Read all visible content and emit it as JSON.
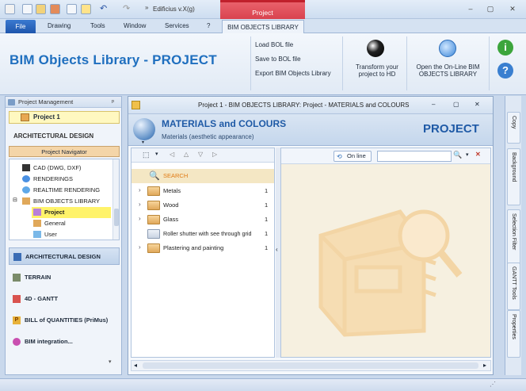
{
  "app": {
    "title": "Edificius v.X(g)",
    "context_tab_group": "Project"
  },
  "ribbon_tabs": {
    "file": "File",
    "drawing": "Drawing",
    "tools": "Tools",
    "window": "Window",
    "services": "Services",
    "help": "?",
    "active": "BIM OBJECTS LIBRARY"
  },
  "ribbon": {
    "big_title": "BIM Objects Library - PROJECT",
    "load": "Load BOL file",
    "save": "Save to BOL file",
    "export": "Export BIM Objects Library",
    "transform_1": "Transform your",
    "transform_2": "project to HD",
    "online_1": "Open the On-Line BIM",
    "online_2": "OBJECTS LIBRARY"
  },
  "left_panel": {
    "header": "Project Management",
    "project": "Project 1",
    "section": "ARCHITECTURAL DESIGN",
    "navigator": "Project Navigator",
    "tree": [
      "CAD (DWG, DXF)",
      "RENDERINGS",
      "REALTIME RENDERING",
      "BIM OBJECTS LIBRARY",
      "Project",
      "General",
      "User"
    ],
    "nav": [
      "ARCHITECTURAL DESIGN",
      "TERRAIN",
      "4D - GANTT",
      "BILL of QUANTITIES (PriMus)",
      "BIM integration..."
    ]
  },
  "main_window": {
    "title": "Project 1 -  BIM OBJECTS LIBRARY: Project - MATERIALS and COLOURS",
    "heading": "MATERIALS and COLOURS",
    "subheading": "Materials (aesthetic appearance)",
    "badge": "PROJECT"
  },
  "list": {
    "search": "SEARCH",
    "items": [
      {
        "label": "Metals",
        "count": "1"
      },
      {
        "label": "Wood",
        "count": "1"
      },
      {
        "label": "Glass",
        "count": "1"
      },
      {
        "label": "Roller shutter with see through grid",
        "count": "1"
      },
      {
        "label": "Plastering and painting",
        "count": "1"
      }
    ]
  },
  "preview": {
    "online_label": "On line",
    "search_value": ""
  },
  "right_tabs": [
    "Copy",
    "Background",
    "Selection Filter",
    "GANTT Tools",
    "Properties"
  ],
  "colors": {
    "accent_blue": "#1f6fbf",
    "context_red": "#d9434f",
    "selected_yellow": "#fff8c0",
    "search_orange": "#e07b14"
  }
}
